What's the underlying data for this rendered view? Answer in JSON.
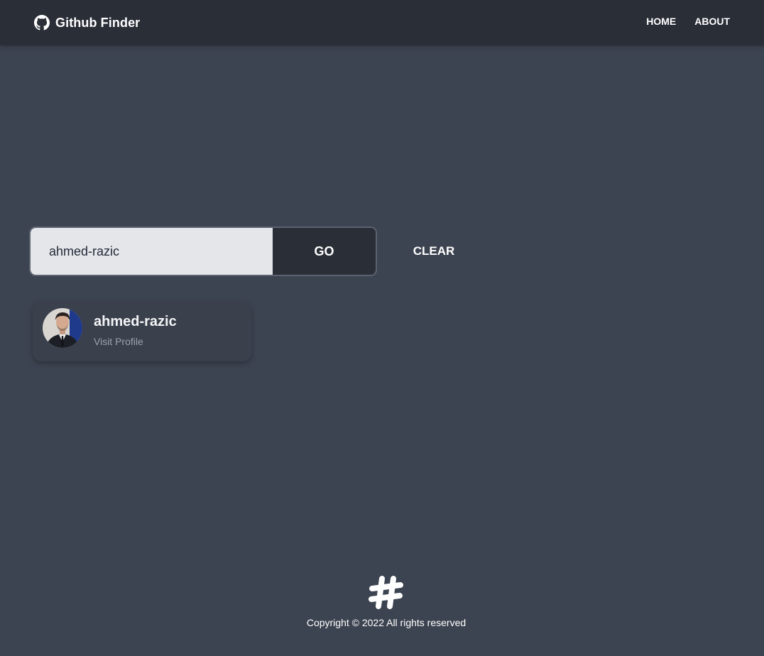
{
  "app": {
    "title": "Github Finder",
    "brand_icon": "github-icon"
  },
  "nav": {
    "items": [
      {
        "label": "HOME"
      },
      {
        "label": "ABOUT"
      }
    ]
  },
  "search": {
    "value": "ahmed-razic",
    "go_label": "GO",
    "clear_label": "CLEAR"
  },
  "results": [
    {
      "username": "ahmed-razic",
      "link_label": "Visit Profile",
      "avatar": "user-avatar-photo"
    }
  ],
  "footer": {
    "logo_icon": "hashtag-icon",
    "copyright": "Copyright © 2022 All rights reserved"
  },
  "colors": {
    "navbar": "#2a2e37",
    "background": "#3d4451",
    "input_bg": "#e5e6e9",
    "go_button": "#2a2e37",
    "text": "#ffffff",
    "muted_text": "#9ca3af"
  }
}
